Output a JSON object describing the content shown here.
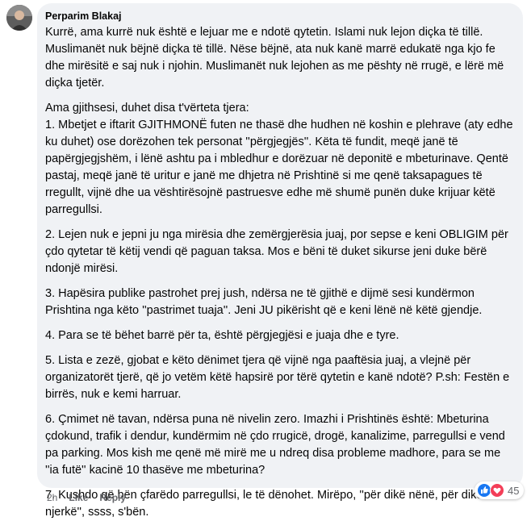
{
  "comment": {
    "author": "Perparim Blakaj",
    "paragraphs": [
      "Kurrë, ama kurrë nuk është e lejuar me e ndotë qytetin. Islami nuk lejon diçka të tillë. Muslimanët nuk bëjnë diçka të tillë. Nëse bëjnë, ata nuk kanë marrë edukatë nga kjo fe dhe mirësitë e saj nuk i njohin. Muslimanët nuk lejohen as me pështy në rrugë, e lërë më diçka tjetër.",
      "Ama gjithsesi, duhet disa t'vërteta tjera:\n1. Mbetjet e iftarit GJITHMONË futen ne thasë dhe hudhen në koshin e plehrave (aty edhe ku duhet) ose dorëzohen tek personat ''përgjegjës''. Këta të fundit, meqë janë të papërgjegjshëm, i lënë ashtu pa i mbledhur e dorëzuar në deponitë e mbeturinave. Qentë pastaj, meqë janë të uritur e janë me dhjetra në Prishtinë si me qenë taksapagues të rregullt, vijnë dhe ua vështirësojnë pastruesve edhe më shumë punën duke krijuar këtë parregullsi.",
      "2. Lejen nuk e jepni ju nga mirësia dhe zemërgjerësia juaj, por sepse e keni OBLIGIM për çdo qytetar të këtij vendi që paguan taksa. Mos e bëni të duket sikurse jeni duke bërë ndonjë mirësi.",
      "3. Hapësira publike pastrohet prej jush, ndërsa ne të gjithë e dijmë sesi kundërmon Prishtina nga këto ''pastrimet tuaja''. Jeni JU pikërisht që e keni lënë në këtë gjendje.",
      "4. Para se të bëhet barrë për ta, është përgjegjësi e juaja dhe e tyre.",
      "5. Lista e zezë, gjobat e këto dënimet tjera që vijnë nga paaftësia juaj, a vlejnë për organizatorët tjerë, që jo vetëm këtë hapsirë por tërë qytetin e kanë ndotë? P.sh: Festën e birrës, nuk e kemi harruar.",
      "6. Çmimet në tavan, ndërsa puna në nivelin zero. Imazhi i Prishtinës është: Mbeturina çdokund, trafik i dendur, kundërmim në çdo rrugicë, drogë, kanalizime, parregullsi e vend pa parking. Mos kish me qenë më mirë me u ndreq disa probleme madhore, para se me ''ia futë'' kacinë 10 thasëve me mbeturina?",
      "7. Kushdo që bën çfarëdo parregullsi, le të dënohet. Mirëpo, ''për dikë nënë, për dikë njerkë'', ssss, s'bën."
    ],
    "time": "2h",
    "like_label": "Like",
    "reply_label": "Reply",
    "reaction_count": "45",
    "reaction_icons": [
      "like-reaction-icon",
      "love-reaction-icon"
    ],
    "colors": {
      "like": "#1877f2",
      "love": "#f33e58",
      "bubble": "#f0f2f5",
      "meta": "#65676b"
    }
  }
}
